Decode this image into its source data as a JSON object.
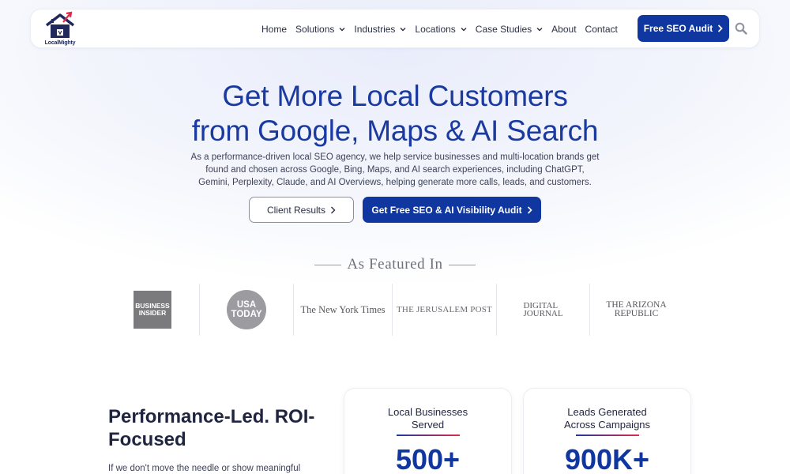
{
  "brand": {
    "name": "LocalMighty"
  },
  "nav": {
    "items": [
      {
        "label": "Home",
        "dropdown": false
      },
      {
        "label": "Solutions",
        "dropdown": true
      },
      {
        "label": "Industries",
        "dropdown": true
      },
      {
        "label": "Locations",
        "dropdown": true
      },
      {
        "label": "Case Studies",
        "dropdown": true
      },
      {
        "label": "About",
        "dropdown": false
      },
      {
        "label": "Contact",
        "dropdown": false
      }
    ],
    "cta_label": "Free SEO Audit",
    "search_icon": "search-icon"
  },
  "hero": {
    "title_line1": "Get More Local Customers",
    "title_line2": "from Google, Maps & AI Search",
    "subtitle": "As a performance-driven local SEO agency, we help service businesses and multi-location brands get found and chosen across Google, Bing, Maps, and AI search experiences, including ChatGPT, Gemini, Perplexity, Claude, and AI Overviews, helping generate more calls, leads, and customers.",
    "secondary_button": "Client Results",
    "primary_button": "Get Free SEO & AI Visibility Audit"
  },
  "featured": {
    "title": "As Featured In",
    "logos": {
      "business_insider": "BUSINESS INSIDER",
      "usa_today_line1": "USA",
      "usa_today_line2": "TODAY",
      "nyt": "The New York Times",
      "jpost": "THE JERUSALEM POST",
      "digital_line1": "DIGITAL",
      "digital_line2": "JOURNAL",
      "arizona_line1": "THE ARIZONA",
      "arizona_line2": "REPUBLIC"
    }
  },
  "performance": {
    "title": "Performance-Led. ROI-Focused",
    "text": "If we don't move the needle or show meaningful"
  },
  "stats": [
    {
      "label_line1": "Local Businesses",
      "label_line2": "Served",
      "value": "500+"
    },
    {
      "label_line1": "Leads Generated",
      "label_line2": "Across Campaigns",
      "value": "900K+"
    }
  ],
  "colors": {
    "brand_blue": "#10369f",
    "title_blue": "#1a3aa0",
    "accent_red": "#e02a4a"
  }
}
